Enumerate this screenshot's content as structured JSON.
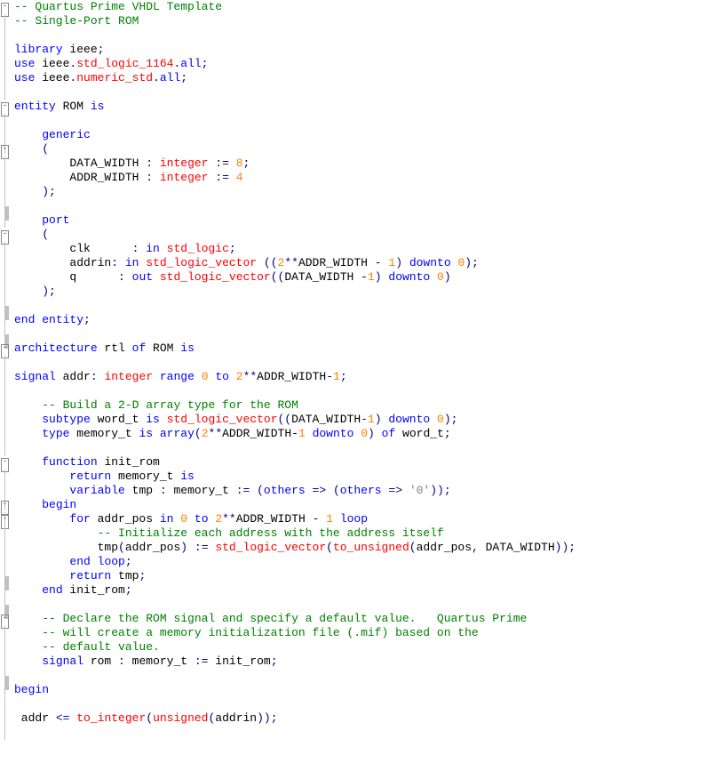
{
  "lines": [
    {
      "g": "fold",
      "spans": [
        [
          "c-comment",
          "-- Quartus Prime VHDL Template"
        ]
      ]
    },
    {
      "g": "v",
      "spans": [
        [
          "c-comment",
          "-- Single-Port ROM"
        ]
      ]
    },
    {
      "g": "v",
      "spans": []
    },
    {
      "g": "v",
      "spans": [
        [
          "c-kw",
          "library"
        ],
        [
          "c-txt",
          " ieee"
        ],
        [
          "c-op",
          ";"
        ]
      ]
    },
    {
      "g": "v",
      "spans": [
        [
          "c-kw",
          "use"
        ],
        [
          "c-txt",
          " ieee"
        ],
        [
          "c-op",
          "."
        ],
        [
          "c-type",
          "std_logic_1164"
        ],
        [
          "c-op",
          "."
        ],
        [
          "c-kw",
          "all"
        ],
        [
          "c-op",
          ";"
        ]
      ]
    },
    {
      "g": "v",
      "spans": [
        [
          "c-kw",
          "use"
        ],
        [
          "c-txt",
          " ieee"
        ],
        [
          "c-op",
          "."
        ],
        [
          "c-type",
          "numeric_std"
        ],
        [
          "c-op",
          "."
        ],
        [
          "c-kw",
          "all"
        ],
        [
          "c-op",
          ";"
        ]
      ]
    },
    {
      "g": "v",
      "spans": []
    },
    {
      "g": "fold",
      "spans": [
        [
          "c-kw",
          "entity"
        ],
        [
          "c-txt",
          " ROM "
        ],
        [
          "c-kw",
          "is"
        ]
      ]
    },
    {
      "g": "v",
      "spans": []
    },
    {
      "g": "v",
      "spans": [
        [
          "c-txt",
          "    "
        ],
        [
          "c-kw",
          "generic"
        ]
      ]
    },
    {
      "g": "fold",
      "spans": [
        [
          "c-txt",
          "    "
        ],
        [
          "c-op",
          "("
        ]
      ]
    },
    {
      "g": "v",
      "spans": [
        [
          "c-txt",
          "        DATA_WIDTH "
        ],
        [
          "c-op",
          ":"
        ],
        [
          "c-txt",
          " "
        ],
        [
          "c-type",
          "integer"
        ],
        [
          "c-txt",
          " "
        ],
        [
          "c-op",
          ":="
        ],
        [
          "c-txt",
          " "
        ],
        [
          "c-num",
          "8"
        ],
        [
          "c-op",
          ";"
        ]
      ]
    },
    {
      "g": "v",
      "spans": [
        [
          "c-txt",
          "        ADDR_WIDTH "
        ],
        [
          "c-op",
          ":"
        ],
        [
          "c-txt",
          " "
        ],
        [
          "c-type",
          "integer"
        ],
        [
          "c-txt",
          " "
        ],
        [
          "c-op",
          ":="
        ],
        [
          "c-txt",
          " "
        ],
        [
          "c-num",
          "4"
        ]
      ]
    },
    {
      "g": "vh",
      "spans": [
        [
          "c-txt",
          "    "
        ],
        [
          "c-op",
          ");"
        ]
      ]
    },
    {
      "g": "v",
      "spans": []
    },
    {
      "g": "v",
      "spans": [
        [
          "c-txt",
          "    "
        ],
        [
          "c-kw",
          "port"
        ]
      ]
    },
    {
      "g": "fold",
      "spans": [
        [
          "c-txt",
          "    "
        ],
        [
          "c-op",
          "("
        ]
      ]
    },
    {
      "g": "v",
      "spans": [
        [
          "c-txt",
          "        clk      "
        ],
        [
          "c-op",
          ":"
        ],
        [
          "c-txt",
          " "
        ],
        [
          "c-kw",
          "in"
        ],
        [
          "c-txt",
          " "
        ],
        [
          "c-type",
          "std_logic"
        ],
        [
          "c-op",
          ";"
        ]
      ]
    },
    {
      "g": "v",
      "spans": [
        [
          "c-txt",
          "        addrin"
        ],
        [
          "c-op",
          ":"
        ],
        [
          "c-txt",
          " "
        ],
        [
          "c-kw",
          "in"
        ],
        [
          "c-txt",
          " "
        ],
        [
          "c-type",
          "std_logic_vector"
        ],
        [
          "c-txt",
          " "
        ],
        [
          "c-op",
          "(("
        ],
        [
          "c-num",
          "2"
        ],
        [
          "c-op",
          "**"
        ],
        [
          "c-txt",
          "ADDR_WIDTH "
        ],
        [
          "c-op",
          "-"
        ],
        [
          "c-txt",
          " "
        ],
        [
          "c-num",
          "1"
        ],
        [
          "c-op",
          ")"
        ],
        [
          "c-txt",
          " "
        ],
        [
          "c-kw",
          "downto"
        ],
        [
          "c-txt",
          " "
        ],
        [
          "c-num",
          "0"
        ],
        [
          "c-op",
          ");"
        ]
      ]
    },
    {
      "g": "v",
      "spans": [
        [
          "c-txt",
          "        q      "
        ],
        [
          "c-op",
          ":"
        ],
        [
          "c-txt",
          " "
        ],
        [
          "c-kw",
          "out"
        ],
        [
          "c-txt",
          " "
        ],
        [
          "c-type",
          "std_logic_vector"
        ],
        [
          "c-op",
          "(("
        ],
        [
          "c-txt",
          "DATA_WIDTH "
        ],
        [
          "c-op",
          "-"
        ],
        [
          "c-num",
          "1"
        ],
        [
          "c-op",
          ")"
        ],
        [
          "c-txt",
          " "
        ],
        [
          "c-kw",
          "downto"
        ],
        [
          "c-txt",
          " "
        ],
        [
          "c-num",
          "0"
        ],
        [
          "c-op",
          ")"
        ]
      ]
    },
    {
      "g": "vh",
      "spans": [
        [
          "c-txt",
          "    "
        ],
        [
          "c-op",
          ");"
        ]
      ]
    },
    {
      "g": "v",
      "spans": []
    },
    {
      "g": "vh",
      "spans": [
        [
          "c-kw",
          "end"
        ],
        [
          "c-txt",
          " "
        ],
        [
          "c-kw",
          "entity"
        ],
        [
          "c-op",
          ";"
        ]
      ]
    },
    {
      "g": "v",
      "spans": []
    },
    {
      "g": "fold",
      "spans": [
        [
          "c-kw",
          "architecture"
        ],
        [
          "c-txt",
          " rtl "
        ],
        [
          "c-kw",
          "of"
        ],
        [
          "c-txt",
          " ROM "
        ],
        [
          "c-kw",
          "is"
        ]
      ]
    },
    {
      "g": "v",
      "spans": []
    },
    {
      "g": "v",
      "spans": [
        [
          "c-kw",
          "signal"
        ],
        [
          "c-txt",
          " addr"
        ],
        [
          "c-op",
          ":"
        ],
        [
          "c-txt",
          " "
        ],
        [
          "c-type",
          "integer"
        ],
        [
          "c-txt",
          " "
        ],
        [
          "c-kw",
          "range"
        ],
        [
          "c-txt",
          " "
        ],
        [
          "c-num",
          "0"
        ],
        [
          "c-txt",
          " "
        ],
        [
          "c-kw",
          "to"
        ],
        [
          "c-txt",
          " "
        ],
        [
          "c-num",
          "2"
        ],
        [
          "c-op",
          "**"
        ],
        [
          "c-txt",
          "ADDR_WIDTH"
        ],
        [
          "c-op",
          "-"
        ],
        [
          "c-num",
          "1"
        ],
        [
          "c-op",
          ";"
        ]
      ]
    },
    {
      "g": "v",
      "spans": []
    },
    {
      "g": "v",
      "spans": [
        [
          "c-txt",
          "    "
        ],
        [
          "c-comment",
          "-- Build a 2-D array type for the ROM"
        ]
      ]
    },
    {
      "g": "v",
      "spans": [
        [
          "c-txt",
          "    "
        ],
        [
          "c-kw",
          "subtype"
        ],
        [
          "c-txt",
          " word_t "
        ],
        [
          "c-kw",
          "is"
        ],
        [
          "c-txt",
          " "
        ],
        [
          "c-type",
          "std_logic_vector"
        ],
        [
          "c-op",
          "(("
        ],
        [
          "c-txt",
          "DATA_WIDTH"
        ],
        [
          "c-op",
          "-"
        ],
        [
          "c-num",
          "1"
        ],
        [
          "c-op",
          ")"
        ],
        [
          "c-txt",
          " "
        ],
        [
          "c-kw",
          "downto"
        ],
        [
          "c-txt",
          " "
        ],
        [
          "c-num",
          "0"
        ],
        [
          "c-op",
          ");"
        ]
      ]
    },
    {
      "g": "v",
      "spans": [
        [
          "c-txt",
          "    "
        ],
        [
          "c-kw",
          "type"
        ],
        [
          "c-txt",
          " memory_t "
        ],
        [
          "c-kw",
          "is"
        ],
        [
          "c-txt",
          " "
        ],
        [
          "c-kw",
          "array"
        ],
        [
          "c-op",
          "("
        ],
        [
          "c-num",
          "2"
        ],
        [
          "c-op",
          "**"
        ],
        [
          "c-txt",
          "ADDR_WIDTH"
        ],
        [
          "c-op",
          "-"
        ],
        [
          "c-num",
          "1"
        ],
        [
          "c-txt",
          " "
        ],
        [
          "c-kw",
          "downto"
        ],
        [
          "c-txt",
          " "
        ],
        [
          "c-num",
          "0"
        ],
        [
          "c-op",
          ")"
        ],
        [
          "c-txt",
          " "
        ],
        [
          "c-kw",
          "of"
        ],
        [
          "c-txt",
          " word_t"
        ],
        [
          "c-op",
          ";"
        ]
      ]
    },
    {
      "g": "v",
      "spans": []
    },
    {
      "g": "fold",
      "spans": [
        [
          "c-txt",
          "    "
        ],
        [
          "c-kw",
          "function"
        ],
        [
          "c-txt",
          " init_rom"
        ]
      ]
    },
    {
      "g": "v",
      "spans": [
        [
          "c-txt",
          "        "
        ],
        [
          "c-kw",
          "return"
        ],
        [
          "c-txt",
          " memory_t "
        ],
        [
          "c-kw",
          "is"
        ]
      ]
    },
    {
      "g": "v",
      "spans": [
        [
          "c-txt",
          "        "
        ],
        [
          "c-kw",
          "variable"
        ],
        [
          "c-txt",
          " tmp "
        ],
        [
          "c-op",
          ":"
        ],
        [
          "c-txt",
          " memory_t "
        ],
        [
          "c-op",
          ":="
        ],
        [
          "c-txt",
          " "
        ],
        [
          "c-op",
          "("
        ],
        [
          "c-kw",
          "others"
        ],
        [
          "c-txt",
          " "
        ],
        [
          "c-op",
          "=>"
        ],
        [
          "c-txt",
          " "
        ],
        [
          "c-op",
          "("
        ],
        [
          "c-kw",
          "others"
        ],
        [
          "c-txt",
          " "
        ],
        [
          "c-op",
          "=>"
        ],
        [
          "c-txt",
          " "
        ],
        [
          "c-char",
          "'0'"
        ],
        [
          "c-op",
          "));"
        ]
      ]
    },
    {
      "g": "fold",
      "spans": [
        [
          "c-txt",
          "    "
        ],
        [
          "c-kw",
          "begin"
        ]
      ]
    },
    {
      "g": "fold",
      "spans": [
        [
          "c-txt",
          "        "
        ],
        [
          "c-kw",
          "for"
        ],
        [
          "c-txt",
          " addr_pos "
        ],
        [
          "c-kw",
          "in"
        ],
        [
          "c-txt",
          " "
        ],
        [
          "c-num",
          "0"
        ],
        [
          "c-txt",
          " "
        ],
        [
          "c-kw",
          "to"
        ],
        [
          "c-txt",
          " "
        ],
        [
          "c-num",
          "2"
        ],
        [
          "c-op",
          "**"
        ],
        [
          "c-txt",
          "ADDR_WIDTH "
        ],
        [
          "c-op",
          "-"
        ],
        [
          "c-txt",
          " "
        ],
        [
          "c-num",
          "1"
        ],
        [
          "c-txt",
          " "
        ],
        [
          "c-kw",
          "loop"
        ]
      ]
    },
    {
      "g": "v",
      "spans": [
        [
          "c-txt",
          "            "
        ],
        [
          "c-comment",
          "-- Initialize each address with the address itself"
        ]
      ]
    },
    {
      "g": "v",
      "spans": [
        [
          "c-txt",
          "            tmp"
        ],
        [
          "c-op",
          "("
        ],
        [
          "c-txt",
          "addr_pos"
        ],
        [
          "c-op",
          ")"
        ],
        [
          "c-txt",
          " "
        ],
        [
          "c-op",
          ":="
        ],
        [
          "c-txt",
          " "
        ],
        [
          "c-type",
          "std_logic_vector"
        ],
        [
          "c-op",
          "("
        ],
        [
          "c-type",
          "to_unsigned"
        ],
        [
          "c-op",
          "("
        ],
        [
          "c-txt",
          "addr_pos"
        ],
        [
          "c-op",
          ","
        ],
        [
          "c-txt",
          " DATA_WIDTH"
        ],
        [
          "c-op",
          "));"
        ]
      ]
    },
    {
      "g": "vh",
      "spans": [
        [
          "c-txt",
          "        "
        ],
        [
          "c-kw",
          "end"
        ],
        [
          "c-txt",
          " "
        ],
        [
          "c-kw",
          "loop"
        ],
        [
          "c-op",
          ";"
        ]
      ]
    },
    {
      "g": "v",
      "spans": [
        [
          "c-txt",
          "        "
        ],
        [
          "c-kw",
          "return"
        ],
        [
          "c-txt",
          " tmp"
        ],
        [
          "c-op",
          ";"
        ]
      ]
    },
    {
      "g": "vh",
      "spans": [
        [
          "c-txt",
          "    "
        ],
        [
          "c-kw",
          "end"
        ],
        [
          "c-txt",
          " init_rom"
        ],
        [
          "c-op",
          ";"
        ]
      ]
    },
    {
      "g": "v",
      "spans": []
    },
    {
      "g": "fold",
      "spans": [
        [
          "c-txt",
          "    "
        ],
        [
          "c-comment",
          "-- Declare the ROM signal and specify a default value.   Quartus Prime"
        ]
      ]
    },
    {
      "g": "v",
      "spans": [
        [
          "c-txt",
          "    "
        ],
        [
          "c-comment",
          "-- will create a memory initialization file (.mif) based on the"
        ]
      ]
    },
    {
      "g": "v",
      "spans": [
        [
          "c-txt",
          "    "
        ],
        [
          "c-comment",
          "-- default value."
        ]
      ]
    },
    {
      "g": "vh",
      "spans": [
        [
          "c-txt",
          "    "
        ],
        [
          "c-kw",
          "signal"
        ],
        [
          "c-txt",
          " rom "
        ],
        [
          "c-op",
          ":"
        ],
        [
          "c-txt",
          " memory_t "
        ],
        [
          "c-op",
          ":="
        ],
        [
          "c-txt",
          " init_rom"
        ],
        [
          "c-op",
          ";"
        ]
      ]
    },
    {
      "g": "v",
      "spans": []
    },
    {
      "g": "v",
      "spans": [
        [
          "c-kw",
          "begin"
        ]
      ]
    },
    {
      "g": "v",
      "spans": []
    },
    {
      "g": "v",
      "spans": [
        [
          "c-txt",
          " addr "
        ],
        [
          "c-op",
          "<="
        ],
        [
          "c-txt",
          " "
        ],
        [
          "c-type",
          "to_integer"
        ],
        [
          "c-op",
          "("
        ],
        [
          "c-type",
          "unsigned"
        ],
        [
          "c-op",
          "("
        ],
        [
          "c-txt",
          "addrin"
        ],
        [
          "c-op",
          "));"
        ]
      ]
    },
    {
      "g": "v",
      "spans": []
    }
  ]
}
